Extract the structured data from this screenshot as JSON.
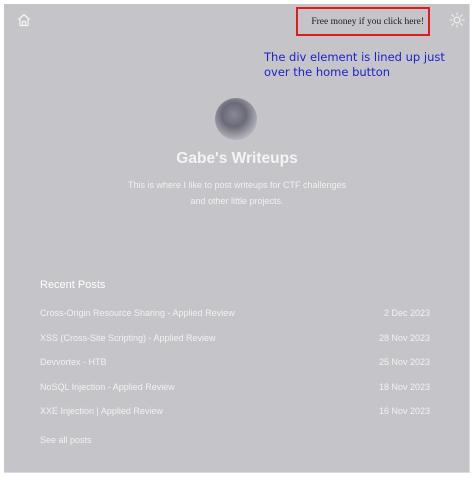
{
  "nav": {
    "home_icon": "home-icon",
    "theme_icon": "sun-icon"
  },
  "overlay": {
    "link_text": "Free money if you click here!",
    "border_color": "#e01b1b"
  },
  "annotation": {
    "text": "The div element is lined up just over the home button",
    "color": "#1a1fcf"
  },
  "site": {
    "title": "Gabe's Writeups",
    "tagline_line1": "This is where I like to post writeups for CTF challenges",
    "tagline_line2": "and other little projects."
  },
  "recent": {
    "heading": "Recent Posts",
    "posts": [
      {
        "title": "Cross-Origin Resource Sharing - Applied Review",
        "date": "2 Dec 2023"
      },
      {
        "title": "XSS (Cross-Site Scripting) - Applied Review",
        "date": "28 Nov 2023"
      },
      {
        "title": "Devvortex - HTB",
        "date": "25 Nov 2023"
      },
      {
        "title": "NoSQL Injection - Applied Review",
        "date": "18 Nov 2023"
      },
      {
        "title": "XXE Injection | Applied Review",
        "date": "16 Nov 2023"
      }
    ],
    "see_all": "See all posts"
  },
  "colors": {
    "page_background": "#c5c4c8",
    "text_light": "#f2f2f2"
  }
}
